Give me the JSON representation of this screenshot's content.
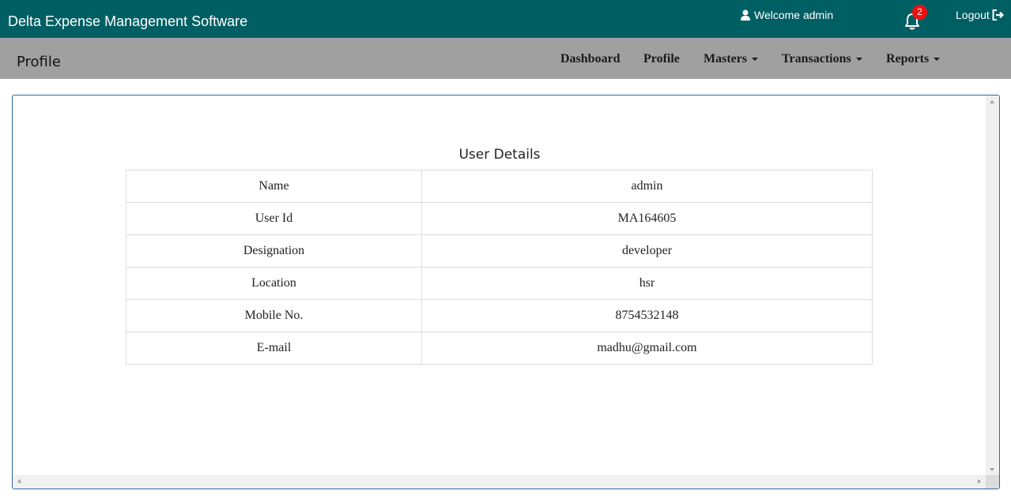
{
  "header": {
    "app_title": "Delta Expense Management Software",
    "welcome_text": "Welcome admin",
    "notification_count": "2",
    "logout_label": "Logout"
  },
  "navbar": {
    "page_title": "Profile",
    "items": [
      {
        "label": "Dashboard",
        "dropdown": false
      },
      {
        "label": "Profile",
        "dropdown": false
      },
      {
        "label": "Masters",
        "dropdown": true
      },
      {
        "label": "Transactions",
        "dropdown": true
      },
      {
        "label": "Reports",
        "dropdown": true
      }
    ]
  },
  "content": {
    "section_title": "User Details",
    "rows": [
      {
        "label": "Name",
        "value": "admin"
      },
      {
        "label": "User Id",
        "value": "MA164605"
      },
      {
        "label": "Designation",
        "value": "developer"
      },
      {
        "label": "Location",
        "value": "hsr"
      },
      {
        "label": "Mobile No.",
        "value": "8754532148"
      },
      {
        "label": "E-mail",
        "value": "madhu@gmail.com"
      }
    ]
  },
  "colors": {
    "topbar": "#005f63",
    "navbar": "#a0a0a0",
    "badge": "#ee1111",
    "frame_border": "#2d6aa8"
  },
  "icons": {
    "user": "user-icon",
    "bell": "bell-icon",
    "logout": "logout-icon"
  }
}
